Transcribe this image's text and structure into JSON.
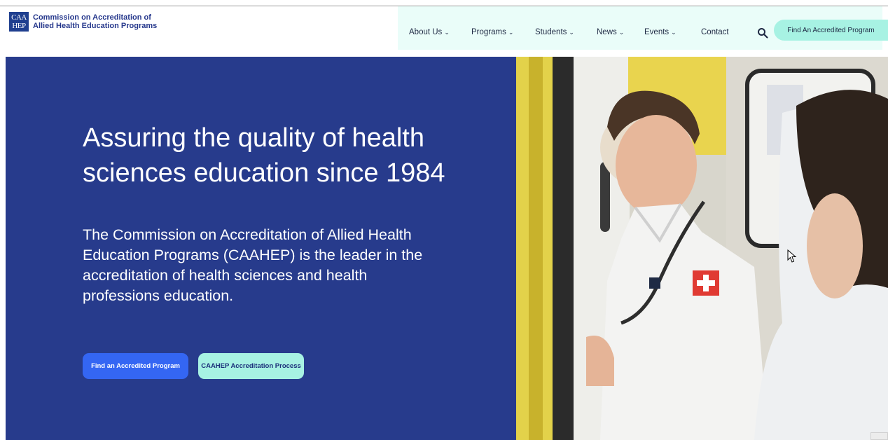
{
  "header": {
    "logo_mark_top": "CAA",
    "logo_mark_bottom": "HEP",
    "org_line1": "Commission on Accreditation of",
    "org_line2": "Allied Health Education Programs"
  },
  "nav": {
    "items": [
      {
        "label": "About Us",
        "has_dropdown": true
      },
      {
        "label": "Programs",
        "has_dropdown": true
      },
      {
        "label": "Students",
        "has_dropdown": true
      },
      {
        "label": "News",
        "has_dropdown": true
      },
      {
        "label": "Events",
        "has_dropdown": true
      },
      {
        "label": "Contact",
        "has_dropdown": false
      }
    ],
    "search_icon": "search-icon",
    "cta_label": "Find An Accredited Program"
  },
  "hero": {
    "title": "Assuring the quality of health sciences education since 1984",
    "description": "The Commission on Accreditation of Allied Health Education Programs (CAAHEP) is the leader in the accreditation of health sciences and health professions education.",
    "primary_button": "Find an Accredited Program",
    "secondary_button": "CAAHEP Accreditation Process"
  },
  "colors": {
    "hero_blue": "#273b8c",
    "primary_button": "#3466f3",
    "mint": "#a7f2e3",
    "nav_band": "#eafdf9"
  }
}
